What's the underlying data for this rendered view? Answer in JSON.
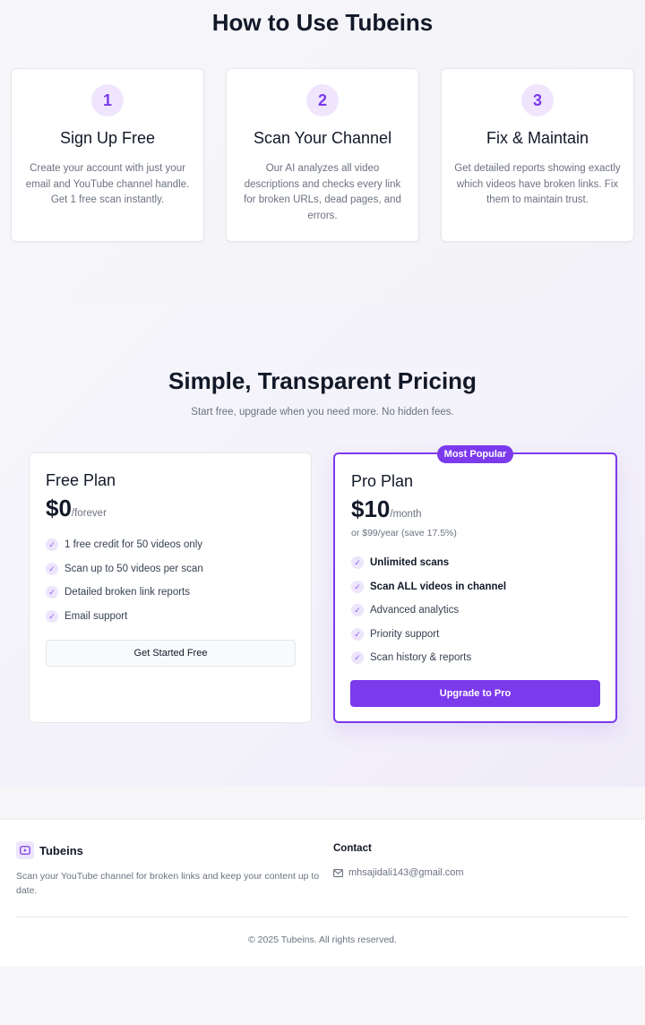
{
  "how_it_works": {
    "title": "How to Use Tubeins",
    "steps": [
      {
        "number": "1",
        "title": "Sign Up Free",
        "text": "Create your account with just your email and YouTube channel handle. Get 1 free scan instantly."
      },
      {
        "number": "2",
        "title": "Scan Your Channel",
        "text": "Our AI analyzes all video descriptions and checks every link for broken URLs, dead pages, and errors."
      },
      {
        "number": "3",
        "title": "Fix & Maintain",
        "text": "Get detailed reports showing exactly which videos have broken links. Fix them to maintain trust."
      }
    ]
  },
  "pricing": {
    "title": "Simple, Transparent Pricing",
    "subtitle": "Start free, upgrade when you need more. No hidden fees.",
    "free_plan": {
      "name": "Free Plan",
      "price": "$0",
      "period": "/forever",
      "features": [
        "1 free credit for 50 videos only",
        "Scan up to 50 videos per scan",
        "Detailed broken link reports",
        "Email support"
      ],
      "cta": "Get Started Free"
    },
    "pro_plan": {
      "badge": "Most Popular",
      "name": "Pro Plan",
      "price": "$10",
      "period": "/month",
      "yearly_note": "or $99/year (save 17.5%)",
      "features": [
        "Unlimited scans",
        "Scan ALL videos in channel",
        "Advanced analytics",
        "Priority support",
        "Scan history & reports"
      ],
      "bold_features": [
        0,
        1
      ],
      "cta": "Upgrade to Pro"
    },
    "check_glyph": "✓"
  },
  "footer": {
    "brand": "Tubeins",
    "brand_icon": "youtube-play-icon",
    "description": "Scan your YouTube channel for broken links and keep your content up to date.",
    "contact_heading": "Contact",
    "email_icon": "mail-icon",
    "email": "mhsajidali143@gmail.com",
    "copyright": "© 2025 Tubeins. All rights reserved."
  },
  "colors": {
    "accent": "#7c3aed",
    "accent_light": "#ede5fc",
    "text_primary": "#111827",
    "text_muted": "#6b7280"
  }
}
